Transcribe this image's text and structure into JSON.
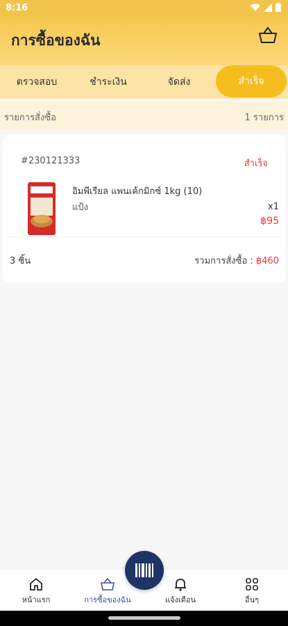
{
  "status": {
    "time": "8:16"
  },
  "header": {
    "title": "การซื้อของฉัน"
  },
  "tabs": [
    {
      "label": "ตรวจสอบ"
    },
    {
      "label": "ชำระเงิน"
    },
    {
      "label": "จัดส่ง"
    },
    {
      "label": "สำเร็จ"
    }
  ],
  "subbar": {
    "left": "รายการสั่งซื้อ",
    "right": "1 รายการ"
  },
  "order": {
    "number": "#230121333",
    "status": "สำเร็จ",
    "item": {
      "name": "อิมพีเรียล แพนเค้กมิกซ์ 1kg (10)",
      "category": "แป้ง",
      "qty": "x1",
      "price": "฿95"
    },
    "pieces": "3 ชิ้น",
    "total_label": "รวมการสั่งซื้อ :",
    "total_amount": "฿460"
  },
  "nav": {
    "home": "หน้าแรก",
    "purchases": "การซื้อของฉัน",
    "notifications": "แจ้งเตือน",
    "others": "อื่นๆ"
  },
  "colors": {
    "accent": "#f6bd1f",
    "status_red": "#e53935",
    "nav_active": "#3f4da5",
    "scan": "#1e3465"
  }
}
